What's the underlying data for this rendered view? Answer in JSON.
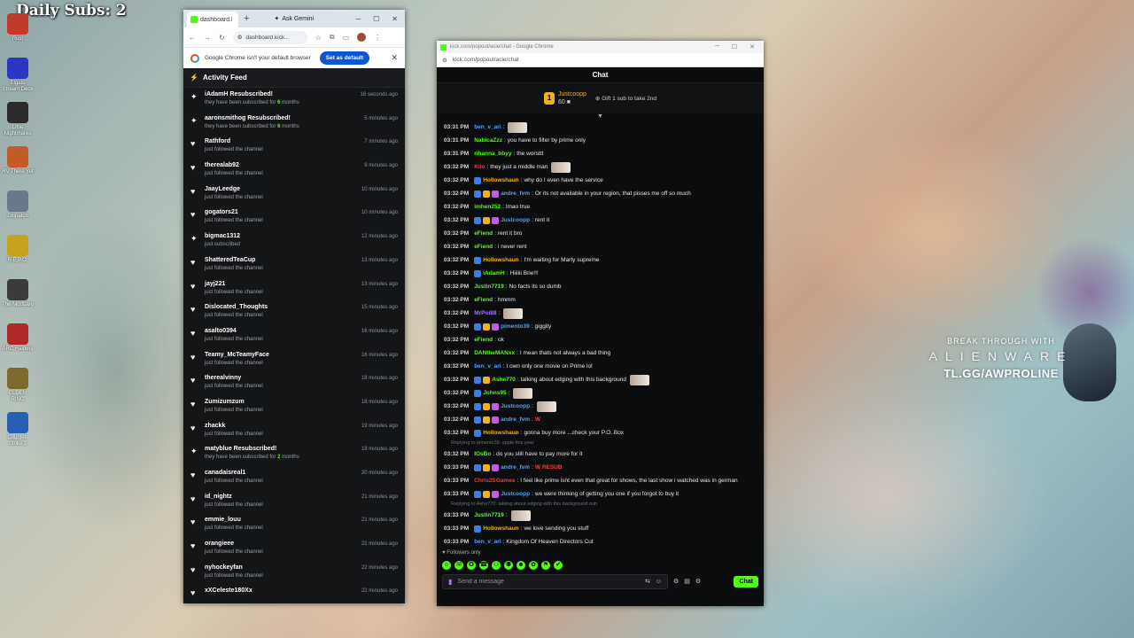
{
  "overlay": {
    "daily_subs": "Daily Subs: 2"
  },
  "desktop": {
    "icons": [
      {
        "label": "Rust",
        "color": "#c0392b"
      },
      {
        "label": "Elgato Stream Deck",
        "color": "#2b36c4"
      },
      {
        "label": "Little Nightmares",
        "color": "#2a2a2a"
      },
      {
        "label": "RV There Yet",
        "color": "#c55a2b"
      },
      {
        "label": "Dispatch",
        "color": "#6b7a8b"
      },
      {
        "label": "R.E.P.O.",
        "color": "#c7a21c"
      },
      {
        "label": "The Mortuary",
        "color": "#3b3b3b"
      },
      {
        "label": "ARC Raiders",
        "color": "#b02a2a"
      },
      {
        "label": "ELDEN RING",
        "color": "#7d6a2e"
      },
      {
        "label": "Counter-Strike 2",
        "color": "#2560b5"
      }
    ]
  },
  "alienware": {
    "line1": "BREAK THROUGH WITH",
    "line2": "ALIENWARE",
    "line3": "TL.GG/AWPROLINE"
  },
  "left_browser": {
    "tab_title": "dashboard.k",
    "new_tab": "+",
    "gemini_label": "Ask Gemini",
    "url": "dashboard.kick...",
    "infobar_text": "Google Chrome isn't your default browser",
    "infobar_button": "Set as default",
    "feed_title": "Activity Feed",
    "feed": [
      {
        "type": "resub",
        "name": "iAdamH Resubscribed!",
        "sub": "they have been subscribed for",
        "months": "6",
        "suffix": "months",
        "time": "16 seconds ago"
      },
      {
        "type": "resub",
        "name": "aaronsmithog Resubscribed!",
        "sub": "they have been subscribed for",
        "months": "6",
        "suffix": "months",
        "time": "5 minutes ago"
      },
      {
        "type": "follow",
        "name": "Rathford",
        "sub": "just followed the channel",
        "time": "7 minutes ago"
      },
      {
        "type": "follow",
        "name": "therealab92",
        "sub": "just followed the channel",
        "time": "9 minutes ago"
      },
      {
        "type": "follow",
        "name": "JaayLeedge",
        "sub": "just followed the channel",
        "time": "10 minutes ago"
      },
      {
        "type": "follow",
        "name": "gogators21",
        "sub": "just followed the channel",
        "time": "10 minutes ago"
      },
      {
        "type": "resub",
        "name": "bigmac1312",
        "sub": "just subscribed",
        "time": "12 minutes ago"
      },
      {
        "type": "follow",
        "name": "ShatteredTeaCup",
        "sub": "just followed the channel",
        "time": "13 minutes ago"
      },
      {
        "type": "follow",
        "name": "jayj221",
        "sub": "just followed the channel",
        "time": "13 minutes ago"
      },
      {
        "type": "follow",
        "name": "Dislocated_Thoughts",
        "sub": "just followed the channel",
        "time": "15 minutes ago"
      },
      {
        "type": "follow",
        "name": "asalto0394",
        "sub": "just followed the channel",
        "time": "16 minutes ago"
      },
      {
        "type": "follow",
        "name": "Teamy_McTeamyFace",
        "sub": "just followed the channel",
        "time": "16 minutes ago"
      },
      {
        "type": "follow",
        "name": "therealvinny",
        "sub": "just followed the channel",
        "time": "18 minutes ago"
      },
      {
        "type": "follow",
        "name": "Zumizumzum",
        "sub": "just followed the channel",
        "time": "18 minutes ago"
      },
      {
        "type": "follow",
        "name": "zhackk",
        "sub": "just followed the channel",
        "time": "19 minutes ago"
      },
      {
        "type": "resub",
        "name": "matyblue Resubscribed!",
        "sub": "they have been subscribed for",
        "months": "2",
        "suffix": "months",
        "time": "19 minutes ago"
      },
      {
        "type": "follow",
        "name": "canadaisreal1",
        "sub": "just followed the channel",
        "time": "20 minutes ago"
      },
      {
        "type": "follow",
        "name": "id_nightz",
        "sub": "just followed the channel",
        "time": "21 minutes ago"
      },
      {
        "type": "follow",
        "name": "emmie_louu",
        "sub": "just followed the channel",
        "time": "21 minutes ago"
      },
      {
        "type": "follow",
        "name": "orangieee",
        "sub": "just followed the channel",
        "time": "21 minutes ago"
      },
      {
        "type": "follow",
        "name": "nyhockeyfan",
        "sub": "just followed the channel",
        "time": "22 minutes ago"
      },
      {
        "type": "follow",
        "name": "xXCeleste180Xx",
        "sub": "",
        "time": "22 minutes ago"
      }
    ]
  },
  "chat_window": {
    "title": "kick.com/popout/acie/chat - Google Chrome",
    "url": "kick.com/popout/acie/chat",
    "header": "Chat",
    "pinned_rank": "1",
    "pinned_user": "Justcoopp",
    "pinned_amount": "60",
    "gift_text": "Gift 1 sub to take 2nd",
    "followers_only": "Followers only",
    "input_placeholder": "Send a message",
    "send_label": "Chat",
    "messages": [
      {
        "time": "03:31 PM",
        "user": "ben_v_ari",
        "color": "#4aa3ff",
        "text": "",
        "emote": true,
        "badges": 0
      },
      {
        "time": "03:31 PM",
        "user": "NabicaZzz",
        "color": "#53fc18",
        "text": "you have to filter by prime only",
        "badges": 0
      },
      {
        "time": "03:31 PM",
        "user": "rihanna_bbyy",
        "color": "#53fc18",
        "text": "the worsttt",
        "badges": 0
      },
      {
        "time": "03:32 PM",
        "user": "Kilo",
        "color": "#e04040",
        "text": "they just a middle man",
        "emote": true,
        "badges": 0
      },
      {
        "time": "03:32 PM",
        "user": "Hollowshaun",
        "color": "#f2b01e",
        "text": "why do I even have the service",
        "badges": 1
      },
      {
        "time": "03:32 PM",
        "user": "andre_fvm",
        "color": "#4aa3ff",
        "text": "Or its not available in your region, that pisses me off so much",
        "badges": 3
      },
      {
        "time": "03:32 PM",
        "user": "imhen252",
        "color": "#53fc18",
        "text": "lmao true",
        "badges": 0
      },
      {
        "time": "03:32 PM",
        "user": "Justcoopp",
        "color": "#4aa3ff",
        "text": "rent it",
        "badges": 3
      },
      {
        "time": "03:32 PM",
        "user": "eFiend",
        "color": "#53fc18",
        "text": "rent it bro",
        "badges": 0
      },
      {
        "time": "03:32 PM",
        "user": "eFiend",
        "color": "#53fc18",
        "text": "i never rent",
        "badges": 0
      },
      {
        "time": "03:32 PM",
        "user": "Hollowshaun",
        "color": "#f2b01e",
        "text": "I'm waiting for Marty supreme",
        "badges": 1
      },
      {
        "time": "03:32 PM",
        "user": "iAdamH",
        "color": "#53fc18",
        "text": "Hiiiiii Brie!!!",
        "badges": 1
      },
      {
        "time": "03:32 PM",
        "user": "Justin7719",
        "color": "#53fc18",
        "text": "No facts its so dumb",
        "badges": 0
      },
      {
        "time": "03:32 PM",
        "user": "eFiend",
        "color": "#53fc18",
        "text": "hmmm",
        "badges": 0
      },
      {
        "time": "03:32 PM",
        "user": "MrPoi88",
        "color": "#b06cff",
        "text": "",
        "emote": true,
        "badges": 0
      },
      {
        "time": "03:32 PM",
        "user": "pimento39",
        "color": "#4aa3ff",
        "text": "giggity",
        "badges": 3
      },
      {
        "time": "03:32 PM",
        "user": "eFiend",
        "color": "#53fc18",
        "text": "ok",
        "badges": 0
      },
      {
        "time": "03:32 PM",
        "user": "DANtheMANxx",
        "color": "#53fc18",
        "text": "I mean thats not always a bad thing",
        "badges": 0
      },
      {
        "time": "03:32 PM",
        "user": "ben_v_ari",
        "color": "#4aa3ff",
        "text": "I own only one movie on Prime lol",
        "badges": 0
      },
      {
        "time": "03:32 PM",
        "user": "Ashe770",
        "color": "#53fc18",
        "text": "talking about edging with this background",
        "emote": true,
        "badges": 2
      },
      {
        "time": "03:32 PM",
        "user": "Johns95",
        "color": "#53fc18",
        "text": "",
        "emote": true,
        "badges": 1
      },
      {
        "time": "03:32 PM",
        "user": "Justcoopp",
        "color": "#4aa3ff",
        "text": "",
        "emote": true,
        "badges": 3
      },
      {
        "time": "03:32 PM",
        "user": "andre_fvm",
        "color": "#4aa3ff",
        "text": "W",
        "badges": 3
      },
      {
        "time": "03:32 PM",
        "user": "Hollowshaun",
        "color": "#f2b01e",
        "text": "gonna buy more ...check your P.O. Box",
        "badges": 1
      },
      {
        "reply": "Replying to pimento39: apple this year"
      },
      {
        "time": "03:32 PM",
        "user": "IOsBo",
        "color": "#53fc18",
        "text": "do you still have to pay more for it",
        "badges": 0
      },
      {
        "time": "03:33 PM",
        "user": "andre_fvm",
        "color": "#4aa3ff",
        "text": "W RESUB",
        "badges": 3
      },
      {
        "time": "03:33 PM",
        "user": "Chris2SGames",
        "color": "#e04040",
        "text": "I feel like prime isnt even that great for shows, the last show i watched was in german",
        "badges": 0
      },
      {
        "time": "03:33 PM",
        "user": "Justcoopp",
        "color": "#4aa3ff",
        "text": "we were thinking of getting you one if you forgot to buy it",
        "badges": 3
      },
      {
        "reply": "Replying to Ashe770: talking about edging with this background ouh"
      },
      {
        "time": "03:33 PM",
        "user": "Justin7719",
        "color": "#53fc18",
        "text": "",
        "emote": true,
        "badges": 0
      },
      {
        "time": "03:33 PM",
        "user": "Hollowshaun",
        "color": "#f2b01e",
        "text": "we love sending you stuff",
        "badges": 1
      },
      {
        "time": "03:33 PM",
        "user": "ben_v_ari",
        "color": "#4aa3ff",
        "text": "Kingdom Of Heaven Directors Cut",
        "badges": 0
      }
    ]
  }
}
